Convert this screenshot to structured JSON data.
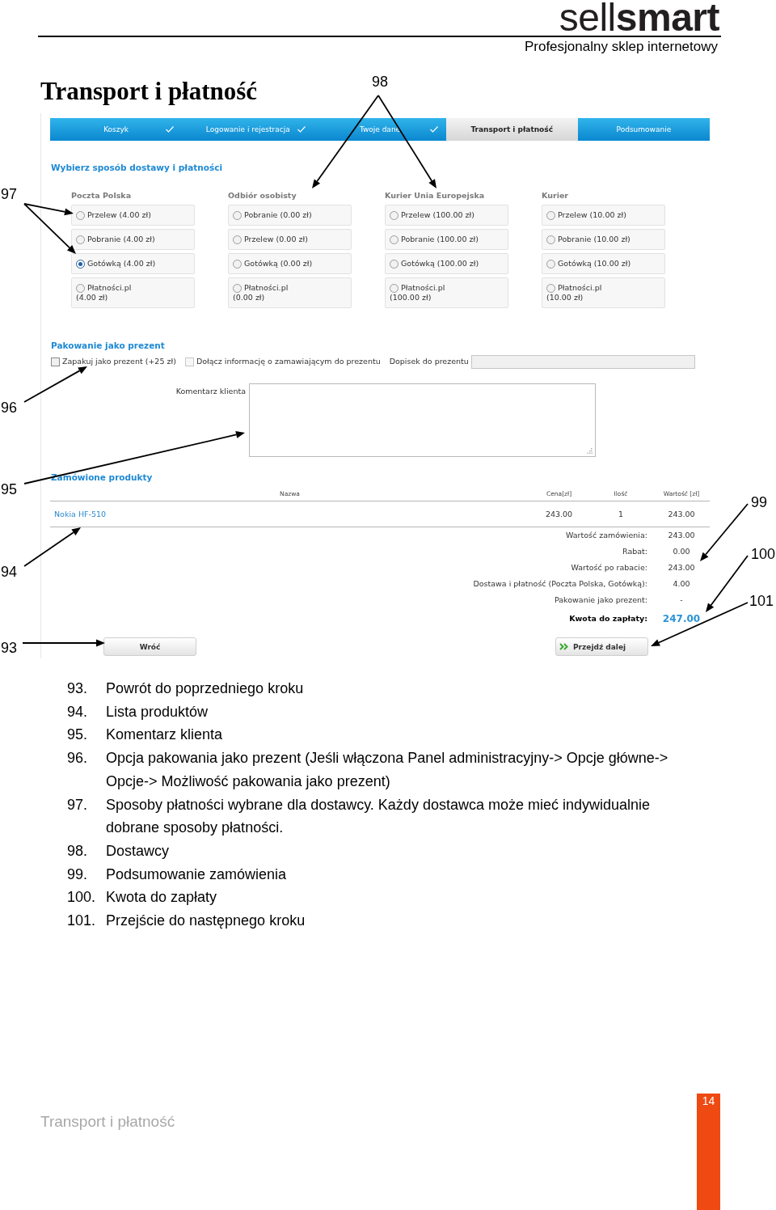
{
  "header": {
    "logo": "sell**smart**",
    "tagline": "Profesjonalny sklep internetowy"
  },
  "title": "Transport i płatność",
  "screenshot": {
    "steps": [
      {
        "label": "Koszyk",
        "done": true,
        "selected": false
      },
      {
        "label": "Logowanie i rejestracja",
        "done": true,
        "selected": false
      },
      {
        "label": "Twoje dane",
        "done": true,
        "selected": false
      },
      {
        "label": "Transport i płatność",
        "done": false,
        "selected": true
      },
      {
        "label": "Podsumowanie",
        "done": false,
        "selected": false
      }
    ],
    "delivery": {
      "heading": "Wybierz sposób dostawy i płatności",
      "columns": [
        {
          "name": "Poczta Polska",
          "options": [
            {
              "label": [
                "Przelew (4.00 zł)"
              ],
              "selected": false
            },
            {
              "label": [
                "Pobranie (4.00 zł)"
              ],
              "selected": false
            },
            {
              "label": [
                "Gotówką (4.00 zł)"
              ],
              "selected": true
            },
            {
              "label": [
                "Płatności.pl",
                "(4.00 zł)"
              ],
              "selected": false
            }
          ]
        },
        {
          "name": "Odbiór osobisty",
          "options": [
            {
              "label": [
                "Pobranie (0.00 zł)"
              ],
              "selected": false
            },
            {
              "label": [
                "Przelew (0.00 zł)"
              ],
              "selected": false
            },
            {
              "label": [
                "Gotówką (0.00 zł)"
              ],
              "selected": false
            },
            {
              "label": [
                "Płatności.pl",
                "(0.00 zł)"
              ],
              "selected": false
            }
          ]
        },
        {
          "name": "Kurier Unia Europejska",
          "options": [
            {
              "label": [
                "Przelew (100.00 zł)"
              ],
              "selected": false
            },
            {
              "label": [
                "Pobranie (100.00 zł)"
              ],
              "selected": false
            },
            {
              "label": [
                "Gotówką (100.00 zł)"
              ],
              "selected": false
            },
            {
              "label": [
                "Płatności.pl",
                "(100.00 zł)"
              ],
              "selected": false
            }
          ]
        },
        {
          "name": "Kurier",
          "options": [
            {
              "label": [
                "Przelew (10.00 zł)"
              ],
              "selected": false
            },
            {
              "label": [
                "Pobranie (10.00 zł)"
              ],
              "selected": false
            },
            {
              "label": [
                "Gotówką (10.00 zł)"
              ],
              "selected": false
            },
            {
              "label": [
                "Płatności.pl",
                "(10.00 zł)"
              ],
              "selected": false
            }
          ]
        }
      ]
    },
    "gift": {
      "heading": "Pakowanie jako prezent",
      "options": [
        {
          "label": "Zapakuj jako prezent (+25 zł)",
          "checked": false,
          "disabled": false
        },
        {
          "label": "Dołącz informację o zamawiającym do prezentu",
          "checked": false,
          "disabled": true
        }
      ],
      "note_label": "Dopisek do prezentu"
    },
    "comment": {
      "label": "Komentarz klienta"
    },
    "products": {
      "heading": "Zamówione produkty",
      "columns": [
        "Nazwa",
        "Cena[zł]",
        "Ilość",
        "Wartość [zł]"
      ],
      "rows": [
        {
          "name": "Nokia HF-510",
          "price": "243.00",
          "quantity": "1",
          "value": "243.00"
        }
      ],
      "summary": [
        {
          "kind": "line",
          "label": "Wartość zamówienia:",
          "value": "243.00"
        },
        {
          "kind": "line",
          "label": "Rabat:",
          "value": "0.00"
        },
        {
          "kind": "line",
          "label": "Wartość po rabacie:",
          "value": "243.00"
        },
        {
          "kind": "line",
          "label": "Dostawa i płatność (Poczta Polska, Gotówką):",
          "value": "4.00"
        },
        {
          "kind": "line",
          "label": "Pakowanie jako prezent:",
          "value": "-"
        },
        {
          "kind": "total",
          "label": "Kwota do zapłaty:",
          "value": "247.00"
        }
      ]
    },
    "buttons": [
      {
        "kind": "back",
        "label": "Wróć"
      },
      {
        "kind": "next",
        "label": "Przejdź dalej"
      }
    ]
  },
  "legend": [
    {
      "number": "93.",
      "text": "Powrót do poprzedniego kroku"
    },
    {
      "number": "94.",
      "text": "Lista produktów"
    },
    {
      "number": "95.",
      "text": "Komentarz klienta"
    },
    {
      "number": "96.",
      "text": "Opcja pakowania jako prezent (Jeśli włączona Panel administracyjny-> Opcje główne-> Opcje-> Możliwość pakowania jako prezent)"
    },
    {
      "number": "97.",
      "text": "Sposoby płatności wybrane dla dostawcy. Każdy dostawca może mieć indywidualnie dobrane sposoby płatności."
    },
    {
      "number": "98.",
      "text": "Dostawcy"
    },
    {
      "number": "99.",
      "text": "Podsumowanie zamówienia"
    },
    {
      "number": "100.",
      "text": "Kwota do zapłaty"
    },
    {
      "number": "101.",
      "text": "Przejście do następnego kroku"
    }
  ],
  "callouts": [
    {
      "label": "98"
    },
    {
      "label": "97"
    },
    {
      "label": "96"
    },
    {
      "label": "95"
    },
    {
      "label": "99"
    },
    {
      "label": "100"
    },
    {
      "label": "94"
    },
    {
      "label": "101"
    },
    {
      "label": "93"
    }
  ],
  "footer": {
    "title": "Transport i płatność",
    "page": "14"
  }
}
